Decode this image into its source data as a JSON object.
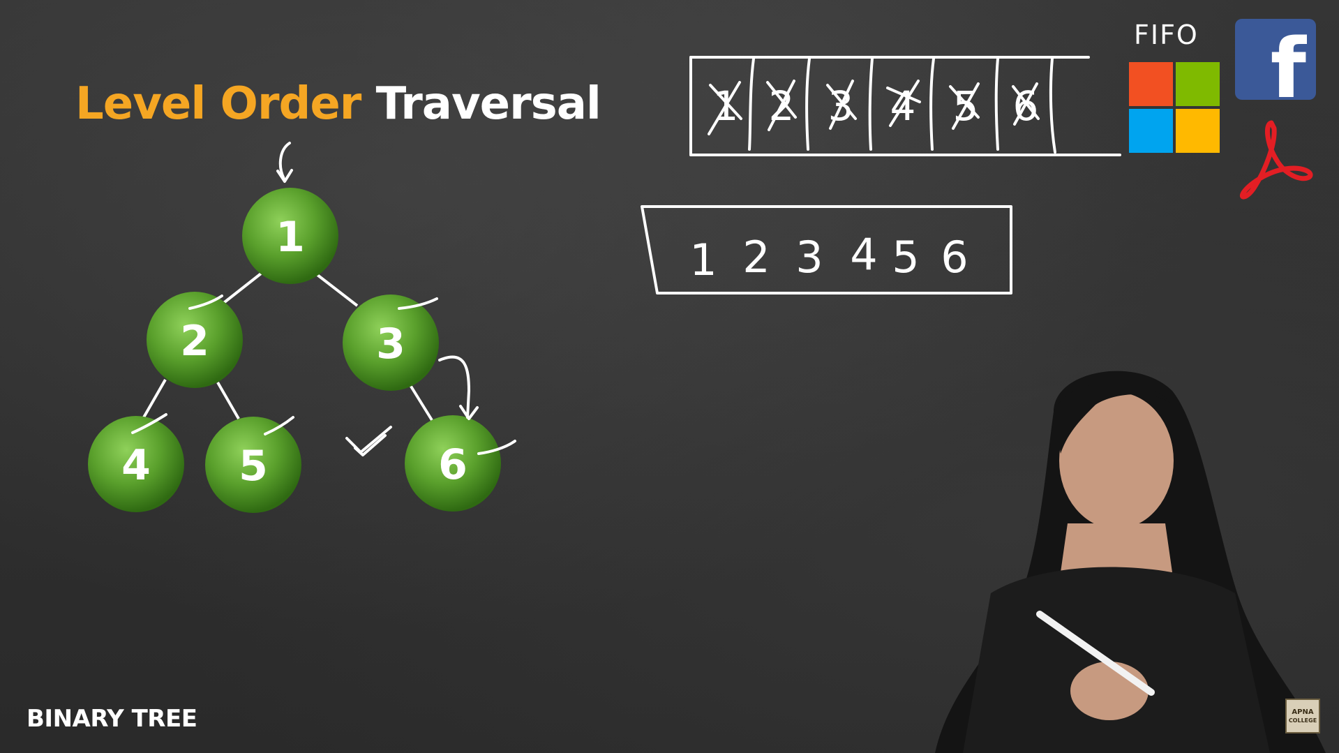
{
  "title": {
    "highlight": "Level Order",
    "rest": "Traversal"
  },
  "footer": {
    "label": "BINARY TREE"
  },
  "tree": {
    "nodes": [
      {
        "id": "1",
        "label": "1"
      },
      {
        "id": "2",
        "label": "2"
      },
      {
        "id": "3",
        "label": "3"
      },
      {
        "id": "4",
        "label": "4"
      },
      {
        "id": "5",
        "label": "5"
      },
      {
        "id": "6",
        "label": "6"
      }
    ],
    "edges": [
      [
        "1",
        "2"
      ],
      [
        "1",
        "3"
      ],
      [
        "2",
        "4"
      ],
      [
        "2",
        "5"
      ],
      [
        "3",
        "6"
      ]
    ],
    "node_color": "#5aa02c"
  },
  "queue": {
    "cells": [
      "1",
      "2",
      "3",
      "4",
      "5",
      "6"
    ],
    "all_crossed": true
  },
  "output": {
    "sequence": [
      "1",
      "2",
      "3",
      "4",
      "5",
      "6"
    ]
  },
  "fifo_label": "FIFO",
  "logos": [
    "microsoft-logo",
    "facebook-logo",
    "acrobat-logo"
  ],
  "watermark": {
    "line1": "APNA",
    "line2": "COLLEGE"
  },
  "colors": {
    "accent": "#f5a623",
    "ms_red": "#f25022",
    "ms_green": "#7fba00",
    "ms_blue": "#00a4ef",
    "ms_yellow": "#ffb900",
    "facebook": "#3b5998",
    "acrobat": "#e31e24"
  }
}
